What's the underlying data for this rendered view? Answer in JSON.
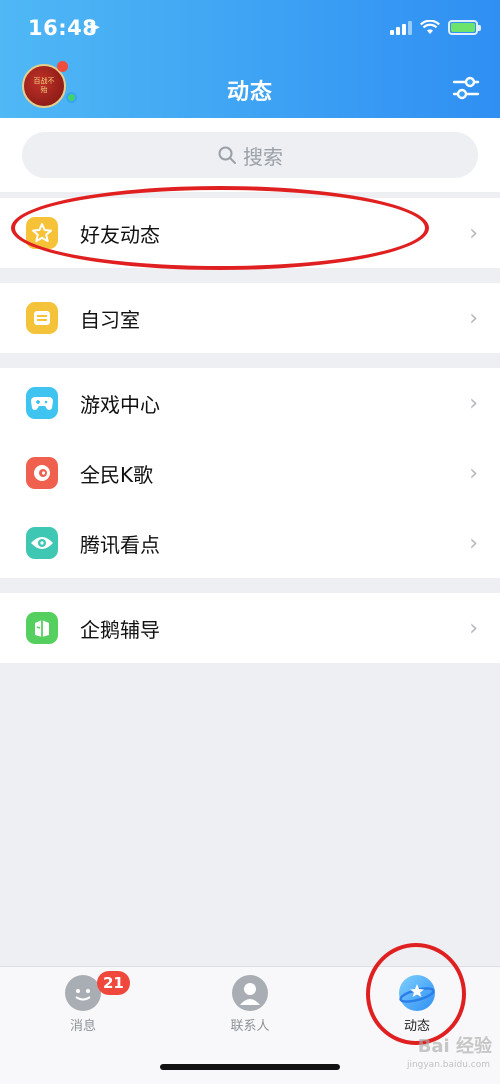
{
  "status": {
    "time": "16:48",
    "location_glyph": "➤",
    "wifi": "wifi-icon",
    "battery": "battery-charging-icon"
  },
  "header": {
    "title": "动态",
    "avatar_text": "百战不殆"
  },
  "search": {
    "placeholder": "搜索"
  },
  "sections": [
    [
      {
        "label": "好友动态",
        "icon": "friend-feed-icon",
        "color": "#f6c338"
      }
    ],
    [
      {
        "label": "自习室",
        "icon": "study-room-icon",
        "color": "#f5c33a"
      }
    ],
    [
      {
        "label": "游戏中心",
        "icon": "game-center-icon",
        "color": "#3fc3f0"
      },
      {
        "label": "全民K歌",
        "icon": "karaoke-icon",
        "color": "#f0604f"
      },
      {
        "label": "腾讯看点",
        "icon": "tencent-kandian-icon",
        "color": "#3ec7b2"
      }
    ],
    [
      {
        "label": "企鹅辅导",
        "icon": "penguin-tutor-icon",
        "color": "#55cf5e"
      }
    ]
  ],
  "chevron": "›",
  "tabbar": {
    "messages": {
      "label": "消息",
      "badge": "21"
    },
    "contacts": {
      "label": "联系人"
    },
    "feed": {
      "label": "动态"
    }
  },
  "watermark": {
    "text": "Bai 经验",
    "sub": "jingyan.baidu.com"
  },
  "colors": {
    "header_start": "#4fb8f5",
    "header_end": "#2f8ff3",
    "annotation_red": "#e02020",
    "badge_red": "#f0483c"
  }
}
